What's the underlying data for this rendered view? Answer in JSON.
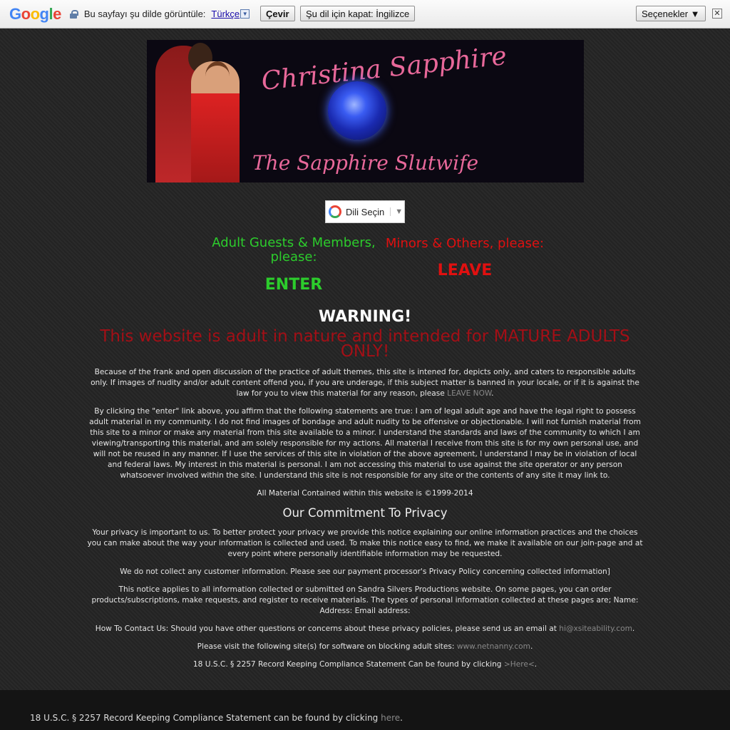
{
  "translate_bar": {
    "logo": [
      "G",
      "o",
      "o",
      "g",
      "l",
      "e"
    ],
    "prompt": "Bu sayfayı şu dilde görüntüle:",
    "language": "Türkçe",
    "translate_button": "Çevir",
    "turn_off_button": "Şu dil için kapat: İngilizce",
    "options_button": "Seçenekler ▼",
    "close": "✕"
  },
  "banner": {
    "title": "Christina Sapphire",
    "subtitle": "The Sapphire Slutwife"
  },
  "language_selector": {
    "label": "Dili Seçin",
    "arrow": "▼"
  },
  "entry": {
    "adult_heading": "Adult Guests & Members, please:",
    "enter_label": "ENTER",
    "minor_heading": "Minors & Others, please:",
    "leave_label": "LEAVE"
  },
  "warning": {
    "title": "WARNING!",
    "subtitle": "This website is adult in nature and intended for MATURE ADULTS ONLY!"
  },
  "disclaimer": {
    "para1_text": "Because of the frank and open discussion of the practice of adult themes, this site is intened for, depicts only, and caters to responsible adults only. If images of nudity and/or adult content offend you, if you are underage, if this subject matter is banned in your locale, or if it is against the law for you to view this material for any reason, please ",
    "para1_link": "LEAVE NOW",
    "para1_end": ".",
    "para2": "By clicking the \"enter\" link above, you affirm that the following statements are true: I am of legal adult age and have the legal right to possess adult material in my community. I do not find images of bondage and adult nudity to be offensive or objectionable. I will not furnish material from this site to a minor or make any material from this site available to a minor. I understand the standards and laws of the community to which I am viewing/transporting this material, and am solely responsible for my actions. All material I receive from this site is for my own personal use, and will not be reused in any manner. If I use the services of this site in violation of the above agreement, I understand I may be in violation of local and federal laws. My interest in this material is personal. I am not accessing this material to use against the site operator or any person whatsoever involved within the site. I understand this site is not responsible for any site or the contents of any site it may link to.",
    "copyright": "All Material Contained within this website is ©1999-2014"
  },
  "privacy": {
    "heading": "Our Commitment To Privacy",
    "para1": "Your privacy is important to us. To better protect your privacy we provide this notice explaining our online information practices and the choices you can make about the way your information is collected and used. To make this notice easy to find, we make it available on our join-page and at every point where personally identifiable information may be requested.",
    "para2": "We do not collect any customer information. Please see our payment processor's Privacy Policy concerning collected information]",
    "para3": "This notice applies to all information collected or submitted on Sandra Silvers Productions website. On some pages, you can order products/subscriptions, make requests, and register to receive materials. The types of personal information collected at these pages are; Name: Address: Email address:",
    "contact_text": "How To Contact Us: Should you have other questions or concerns about these privacy policies, please send us an email at ",
    "contact_email": "hi@xsiteability.com",
    "contact_end": ".",
    "software_text": "Please visit the following site(s) for software on blocking adult sites: ",
    "software_link": "www.netnanny.com",
    "software_end": ".",
    "compliance_text": "18 U.S.C. § 2257 Record Keeping Compliance Statement Can be found by clicking ",
    "compliance_link": ">Here<",
    "compliance_end": "."
  },
  "footer": {
    "compliance_text": "18 U.S.C. § 2257 Record Keeping Compliance Statement can be found by clicking ",
    "compliance_link": "here",
    "compliance_end": "."
  }
}
